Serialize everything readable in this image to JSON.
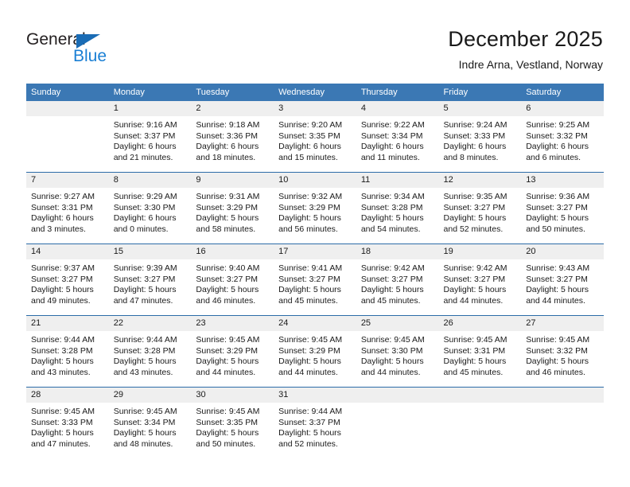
{
  "brand": {
    "name_top": "General",
    "name_bottom": "Blue",
    "accent_color": "#1a7fd4",
    "triangle_color": "#1a6cb5"
  },
  "header": {
    "title": "December 2025",
    "subtitle": "Indre Arna, Vestland, Norway"
  },
  "theme": {
    "header_row_bg": "#3b78b4",
    "row_divider": "#2c6ca8",
    "daynum_band_bg": "#efefef",
    "text_color": "#1a1a1a"
  },
  "weekday_headers": [
    "Sunday",
    "Monday",
    "Tuesday",
    "Wednesday",
    "Thursday",
    "Friday",
    "Saturday"
  ],
  "labels": {
    "sunrise_prefix": "Sunrise:",
    "sunset_prefix": "Sunset:",
    "daylight_prefix": "Daylight:"
  },
  "weeks": [
    [
      {
        "day": "",
        "empty": true,
        "line1": "",
        "line2": "",
        "line3": "",
        "line4": ""
      },
      {
        "day": "1",
        "line1": "Sunrise: 9:16 AM",
        "line2": "Sunset: 3:37 PM",
        "line3": "Daylight: 6 hours",
        "line4": "and 21 minutes."
      },
      {
        "day": "2",
        "line1": "Sunrise: 9:18 AM",
        "line2": "Sunset: 3:36 PM",
        "line3": "Daylight: 6 hours",
        "line4": "and 18 minutes."
      },
      {
        "day": "3",
        "line1": "Sunrise: 9:20 AM",
        "line2": "Sunset: 3:35 PM",
        "line3": "Daylight: 6 hours",
        "line4": "and 15 minutes."
      },
      {
        "day": "4",
        "line1": "Sunrise: 9:22 AM",
        "line2": "Sunset: 3:34 PM",
        "line3": "Daylight: 6 hours",
        "line4": "and 11 minutes."
      },
      {
        "day": "5",
        "line1": "Sunrise: 9:24 AM",
        "line2": "Sunset: 3:33 PM",
        "line3": "Daylight: 6 hours",
        "line4": "and 8 minutes."
      },
      {
        "day": "6",
        "line1": "Sunrise: 9:25 AM",
        "line2": "Sunset: 3:32 PM",
        "line3": "Daylight: 6 hours",
        "line4": "and 6 minutes."
      }
    ],
    [
      {
        "day": "7",
        "line1": "Sunrise: 9:27 AM",
        "line2": "Sunset: 3:31 PM",
        "line3": "Daylight: 6 hours",
        "line4": "and 3 minutes."
      },
      {
        "day": "8",
        "line1": "Sunrise: 9:29 AM",
        "line2": "Sunset: 3:30 PM",
        "line3": "Daylight: 6 hours",
        "line4": "and 0 minutes."
      },
      {
        "day": "9",
        "line1": "Sunrise: 9:31 AM",
        "line2": "Sunset: 3:29 PM",
        "line3": "Daylight: 5 hours",
        "line4": "and 58 minutes."
      },
      {
        "day": "10",
        "line1": "Sunrise: 9:32 AM",
        "line2": "Sunset: 3:29 PM",
        "line3": "Daylight: 5 hours",
        "line4": "and 56 minutes."
      },
      {
        "day": "11",
        "line1": "Sunrise: 9:34 AM",
        "line2": "Sunset: 3:28 PM",
        "line3": "Daylight: 5 hours",
        "line4": "and 54 minutes."
      },
      {
        "day": "12",
        "line1": "Sunrise: 9:35 AM",
        "line2": "Sunset: 3:27 PM",
        "line3": "Daylight: 5 hours",
        "line4": "and 52 minutes."
      },
      {
        "day": "13",
        "line1": "Sunrise: 9:36 AM",
        "line2": "Sunset: 3:27 PM",
        "line3": "Daylight: 5 hours",
        "line4": "and 50 minutes."
      }
    ],
    [
      {
        "day": "14",
        "line1": "Sunrise: 9:37 AM",
        "line2": "Sunset: 3:27 PM",
        "line3": "Daylight: 5 hours",
        "line4": "and 49 minutes."
      },
      {
        "day": "15",
        "line1": "Sunrise: 9:39 AM",
        "line2": "Sunset: 3:27 PM",
        "line3": "Daylight: 5 hours",
        "line4": "and 47 minutes."
      },
      {
        "day": "16",
        "line1": "Sunrise: 9:40 AM",
        "line2": "Sunset: 3:27 PM",
        "line3": "Daylight: 5 hours",
        "line4": "and 46 minutes."
      },
      {
        "day": "17",
        "line1": "Sunrise: 9:41 AM",
        "line2": "Sunset: 3:27 PM",
        "line3": "Daylight: 5 hours",
        "line4": "and 45 minutes."
      },
      {
        "day": "18",
        "line1": "Sunrise: 9:42 AM",
        "line2": "Sunset: 3:27 PM",
        "line3": "Daylight: 5 hours",
        "line4": "and 45 minutes."
      },
      {
        "day": "19",
        "line1": "Sunrise: 9:42 AM",
        "line2": "Sunset: 3:27 PM",
        "line3": "Daylight: 5 hours",
        "line4": "and 44 minutes."
      },
      {
        "day": "20",
        "line1": "Sunrise: 9:43 AM",
        "line2": "Sunset: 3:27 PM",
        "line3": "Daylight: 5 hours",
        "line4": "and 44 minutes."
      }
    ],
    [
      {
        "day": "21",
        "line1": "Sunrise: 9:44 AM",
        "line2": "Sunset: 3:28 PM",
        "line3": "Daylight: 5 hours",
        "line4": "and 43 minutes."
      },
      {
        "day": "22",
        "line1": "Sunrise: 9:44 AM",
        "line2": "Sunset: 3:28 PM",
        "line3": "Daylight: 5 hours",
        "line4": "and 43 minutes."
      },
      {
        "day": "23",
        "line1": "Sunrise: 9:45 AM",
        "line2": "Sunset: 3:29 PM",
        "line3": "Daylight: 5 hours",
        "line4": "and 44 minutes."
      },
      {
        "day": "24",
        "line1": "Sunrise: 9:45 AM",
        "line2": "Sunset: 3:29 PM",
        "line3": "Daylight: 5 hours",
        "line4": "and 44 minutes."
      },
      {
        "day": "25",
        "line1": "Sunrise: 9:45 AM",
        "line2": "Sunset: 3:30 PM",
        "line3": "Daylight: 5 hours",
        "line4": "and 44 minutes."
      },
      {
        "day": "26",
        "line1": "Sunrise: 9:45 AM",
        "line2": "Sunset: 3:31 PM",
        "line3": "Daylight: 5 hours",
        "line4": "and 45 minutes."
      },
      {
        "day": "27",
        "line1": "Sunrise: 9:45 AM",
        "line2": "Sunset: 3:32 PM",
        "line3": "Daylight: 5 hours",
        "line4": "and 46 minutes."
      }
    ],
    [
      {
        "day": "28",
        "line1": "Sunrise: 9:45 AM",
        "line2": "Sunset: 3:33 PM",
        "line3": "Daylight: 5 hours",
        "line4": "and 47 minutes."
      },
      {
        "day": "29",
        "line1": "Sunrise: 9:45 AM",
        "line2": "Sunset: 3:34 PM",
        "line3": "Daylight: 5 hours",
        "line4": "and 48 minutes."
      },
      {
        "day": "30",
        "line1": "Sunrise: 9:45 AM",
        "line2": "Sunset: 3:35 PM",
        "line3": "Daylight: 5 hours",
        "line4": "and 50 minutes."
      },
      {
        "day": "31",
        "line1": "Sunrise: 9:44 AM",
        "line2": "Sunset: 3:37 PM",
        "line3": "Daylight: 5 hours",
        "line4": "and 52 minutes."
      },
      {
        "day": "",
        "empty": true,
        "line1": "",
        "line2": "",
        "line3": "",
        "line4": ""
      },
      {
        "day": "",
        "empty": true,
        "line1": "",
        "line2": "",
        "line3": "",
        "line4": ""
      },
      {
        "day": "",
        "empty": true,
        "line1": "",
        "line2": "",
        "line3": "",
        "line4": ""
      }
    ]
  ]
}
